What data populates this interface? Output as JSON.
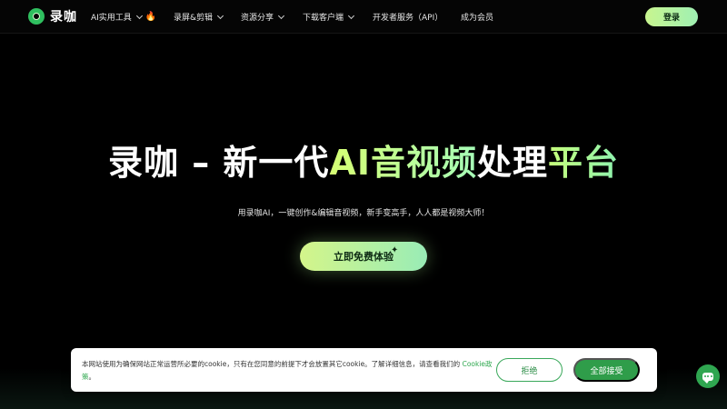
{
  "nav": {
    "logo_text": "录咖",
    "items": [
      {
        "label": "AI实用工具",
        "chevron": true,
        "badge": "🔥"
      },
      {
        "label": "录屏&剪辑",
        "chevron": true
      },
      {
        "label": "资源分享",
        "chevron": true
      },
      {
        "label": "下载客户端",
        "chevron": true
      },
      {
        "label": "开发者服务（API）",
        "chevron": false
      },
      {
        "label": "成为会员",
        "chevron": false
      }
    ],
    "login_label": "登录"
  },
  "hero": {
    "title_part1": "录咖 – 新一代",
    "title_part2": "AI音视频",
    "title_part3": "处理",
    "title_part4": "平台",
    "subtitle": "用录咖AI，一键创作&编辑音视频，新手变高手，人人都是视频大师！",
    "cta_label": "立即免费体验",
    "cta_icon": "sparkle-icon"
  },
  "cookie_banner": {
    "text": "本网站使用为确保网站正常运营所必要的cookie，只有在您同意的前提下才会放置其它cookie。了解详细信息，请查看我们的 ",
    "link_label": "Cookie政策",
    "text_end": "。",
    "reject_label": "拒绝",
    "accept_label": "全部接受"
  },
  "colors": {
    "accent_green": "#2f9d4a",
    "cta_gradient_start": "#d4f58a",
    "cta_gradient_end": "#99ecb6",
    "background": "#000000"
  }
}
